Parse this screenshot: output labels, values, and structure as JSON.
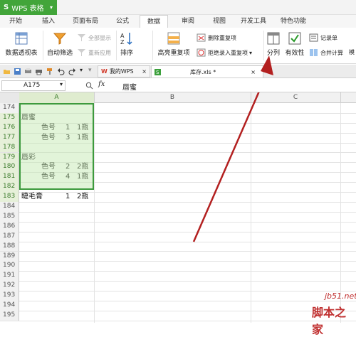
{
  "titlebar": {
    "app_name": "WPS 表格",
    "logo": "S"
  },
  "tabs": [
    "开始",
    "插入",
    "页面布局",
    "公式",
    "数据",
    "审阅",
    "视图",
    "开发工具",
    "特色功能"
  ],
  "ribbon": {
    "pivot": "数据透视表",
    "autofilter": "自动筛选",
    "show_all": "全部显示",
    "reapply": "重新应用",
    "sort": "排序",
    "highlight_dup": "高亮重复项",
    "remove_dup": "删除重复项",
    "reject_dup": "拒绝录入重复项",
    "split": "分列",
    "validity": "有效性",
    "record": "记录单",
    "consolidate": "合并计算",
    "more": "模"
  },
  "docbar": {
    "doc1": "我的WPS",
    "doc2": "库存.xls *"
  },
  "formula": {
    "cell_ref": "A175",
    "fx": "fx",
    "value": "唇蜜"
  },
  "columns": [
    "A",
    "B",
    "C"
  ],
  "rows": [
    {
      "n": "174",
      "a": "",
      "num": "",
      "unit": ""
    },
    {
      "n": "175",
      "a": "唇蜜",
      "num": "",
      "unit": ""
    },
    {
      "n": "176",
      "a": "色号",
      "num": "1",
      "unit": "1瓶"
    },
    {
      "n": "177",
      "a": "色号",
      "num": "3",
      "unit": "1瓶"
    },
    {
      "n": "178",
      "a": "",
      "num": "",
      "unit": ""
    },
    {
      "n": "179",
      "a": "唇彩",
      "num": "",
      "unit": ""
    },
    {
      "n": "180",
      "a": "色号",
      "num": "2",
      "unit": "2瓶"
    },
    {
      "n": "181",
      "a": "色号",
      "num": "4",
      "unit": "1瓶"
    },
    {
      "n": "182",
      "a": "",
      "num": "",
      "unit": ""
    },
    {
      "n": "183",
      "a": "睫毛膏",
      "num": "1",
      "unit": "2瓶"
    },
    {
      "n": "184",
      "a": "",
      "num": "",
      "unit": ""
    },
    {
      "n": "185",
      "a": "",
      "num": "",
      "unit": ""
    },
    {
      "n": "186",
      "a": "",
      "num": "",
      "unit": ""
    },
    {
      "n": "187",
      "a": "",
      "num": "",
      "unit": ""
    },
    {
      "n": "188",
      "a": "",
      "num": "",
      "unit": ""
    },
    {
      "n": "189",
      "a": "",
      "num": "",
      "unit": ""
    },
    {
      "n": "190",
      "a": "",
      "num": "",
      "unit": ""
    },
    {
      "n": "191",
      "a": "",
      "num": "",
      "unit": ""
    },
    {
      "n": "192",
      "a": "",
      "num": "",
      "unit": ""
    },
    {
      "n": "193",
      "a": "",
      "num": "",
      "unit": ""
    },
    {
      "n": "194",
      "a": "",
      "num": "",
      "unit": ""
    },
    {
      "n": "195",
      "a": "",
      "num": "",
      "unit": ""
    }
  ],
  "watermark": {
    "site": "jb51.net",
    "name": "脚本之家"
  }
}
